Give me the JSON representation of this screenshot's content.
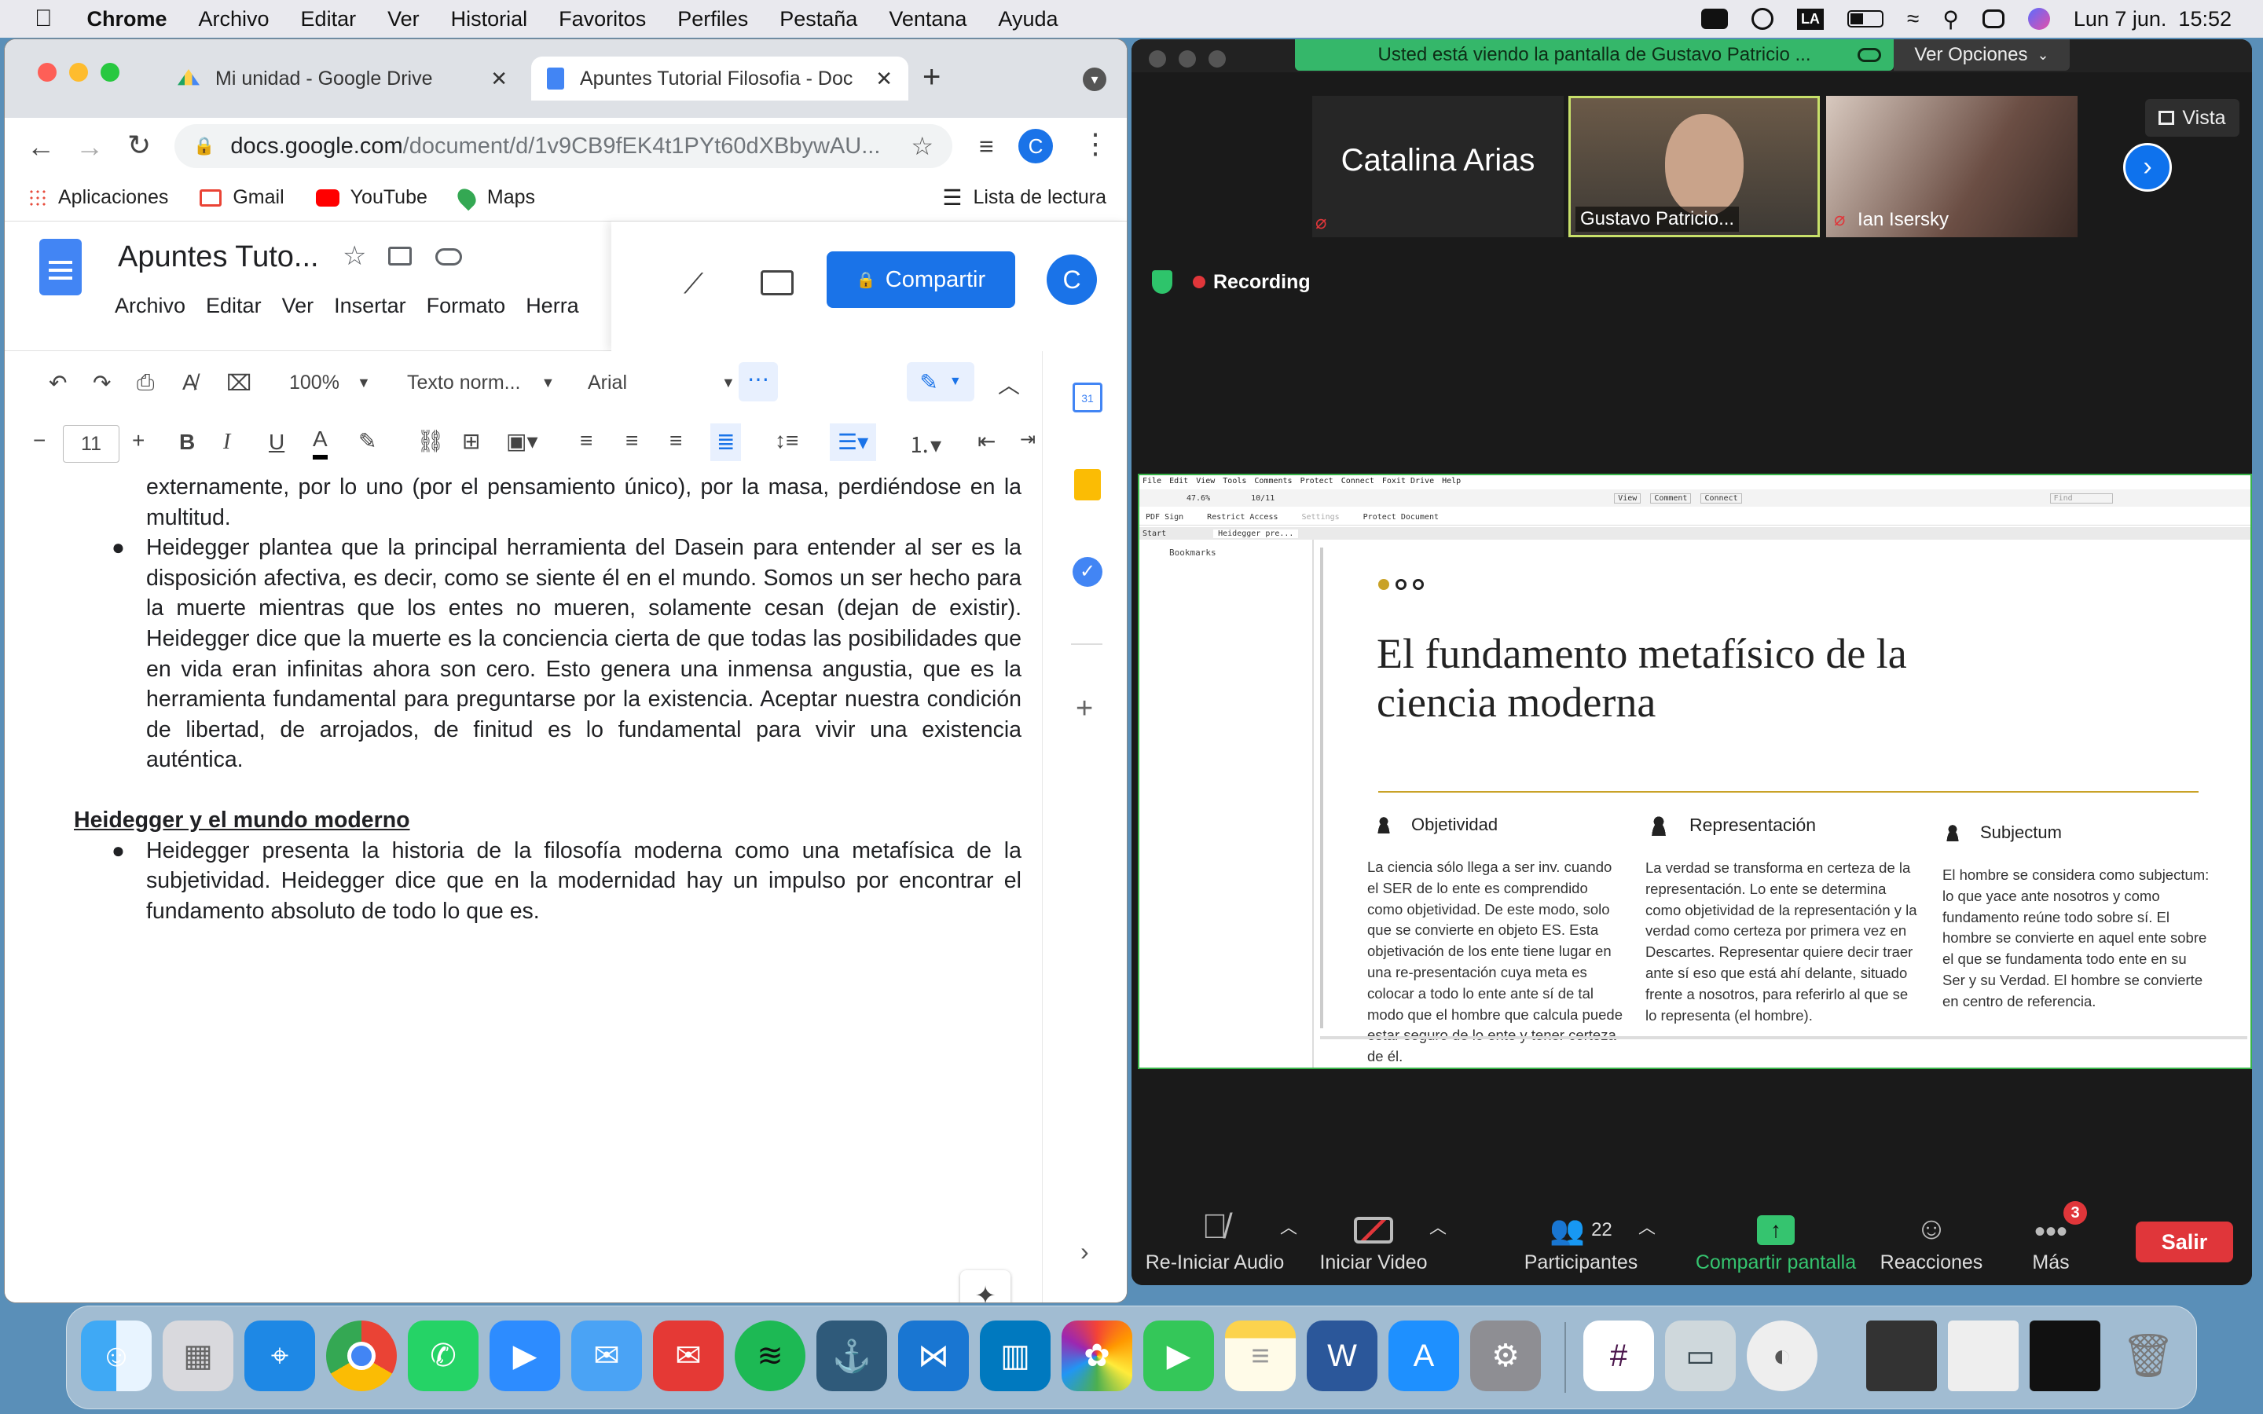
{
  "menubar": {
    "app": "Chrome",
    "items": [
      "Archivo",
      "Editar",
      "Ver",
      "Historial",
      "Favoritos",
      "Perfiles",
      "Pestaña",
      "Ventana",
      "Ayuda"
    ],
    "status_la": "LA",
    "clock": "Lun 7 jun.  15:52"
  },
  "chrome": {
    "tabs": [
      {
        "title": "Mi unidad - Google Drive"
      },
      {
        "title": "Apuntes Tutorial Filosofia - Doc"
      }
    ],
    "new_tab": "+",
    "url_domain": "docs.google.com",
    "url_path": "/document/d/1v9CB9fEK4t1PYt60dXBbywAU...",
    "profile_initial": "C",
    "bookmarks": [
      "Aplicaciones",
      "Gmail",
      "YouTube",
      "Maps"
    ],
    "reading_list": "Lista de lectura"
  },
  "docs": {
    "title": "Apuntes Tuto...",
    "menus": [
      "Archivo",
      "Editar",
      "Ver",
      "Insertar",
      "Formato",
      "Herra"
    ],
    "share_label": "Compartir",
    "avatar": "C",
    "zoom": "100%",
    "style": "Texto norm...",
    "font": "Arial",
    "font_size": "11",
    "para_top": "externamente, por lo uno (por el pensamiento único), por la masa, perdiéndose en la multitud.",
    "bullet1": "Heidegger plantea que la principal herramienta del Dasein para entender al ser es la disposición afectiva, es decir, como se siente él en el mundo. Somos un ser hecho para la muerte mientras que los entes no mueren, solamente cesan (dejan de existir). Heidegger dice que la muerte es la conciencia cierta de que todas las posibilidades que en vida eran infinitas ahora son cero. Esto genera una inmensa angustia, que es la herramienta fundamental para preguntarse por la existencia. Aceptar nuestra condición de libertad, de arrojados, de finitud es lo fundamental para vivir una existencia auténtica.",
    "heading": "Heidegger y el mundo moderno",
    "bullet2": "Heidegger presenta la historia de la filosofía moderna como una metafísica de la subjetividad. Heidegger dice que en la modernidad hay un impulso por encontrar el fundamento absoluto de todo lo que es.",
    "side_calendar_day": "31"
  },
  "zoom": {
    "banner": "Usted está viendo la pantalla de Gustavo Patricio ...",
    "view_options": "Ver Opciones",
    "vista": "Vista",
    "participants": [
      {
        "name": "Catalina Arias"
      },
      {
        "name": "Gustavo Patricio..."
      },
      {
        "name": "Ian Isersky"
      }
    ],
    "recording": "Recording",
    "controls": {
      "audio": "Re-Iniciar Audio",
      "video": "Iniciar Video",
      "participants": "Participantes",
      "participants_count": "22",
      "share": "Compartir pantalla",
      "reactions": "Reacciones",
      "more": "Más",
      "more_badge": "3",
      "leave": "Salir"
    }
  },
  "pdf": {
    "menu": [
      "File",
      "Edit",
      "View",
      "Tools",
      "Comments",
      "Protect",
      "Connect",
      "Foxit Drive",
      "Help"
    ],
    "zoom": "47.6%",
    "page": "10/11",
    "view_btn": "View",
    "comment_btn": "Comment",
    "connect_btn": "Connect",
    "find_placeholder": "Find",
    "pdf_sign": "PDF Sign",
    "restrict": "Restrict Access",
    "settings": "Settings",
    "protect": "Protect Document",
    "tab_start": "Start",
    "tab_doc": "Heidegger pre...",
    "bookmarks": "Bookmarks",
    "slide_title": "El fundamento metafísico de la ciencia moderna",
    "columns": [
      {
        "heading": "Objetividad",
        "body": "La ciencia sólo llega a ser inv. cuando el SER de lo ente es comprendido como objetividad. De este modo, solo que se convierte en objeto ES. Esta objetivación de los ente tiene lugar en una re-presentación cuya meta es colocar a todo lo ente ante sí de tal modo que el hombre que calcula puede estar seguro de lo ente y tener certeza de él."
      },
      {
        "heading": "Representación",
        "body": "La verdad se transforma en certeza de la representación. Lo ente se determina como objetividad de la representación y la verdad como certeza por primera vez en Descartes. Representar quiere decir traer ante sí eso que está ahí delante, situado frente a nosotros, para referirlo al que se lo representa (el hombre)."
      },
      {
        "heading": "Subjectum",
        "body": "El hombre se considera como subjectum: lo que yace ante nosotros y como fundamento reúne todo sobre sí. El hombre se convierte en aquel ente sobre el que se fundamenta todo ente en su Ser y su Verdad.  El hombre se convierte en centro de referencia."
      }
    ]
  },
  "colors": {
    "docs_blue": "#1a73e8",
    "zoom_green": "#35b76a",
    "leave_red": "#e0363a",
    "pdf_gold": "#c9a227"
  }
}
